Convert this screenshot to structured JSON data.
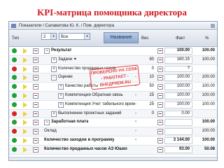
{
  "slide": {
    "title": "KPI-матрица помощника директора"
  },
  "app": {
    "breadcrumb": "Показатели / Салаватова Ю. К. / Пом. директора",
    "filters": {
      "type_label": "Тип",
      "level_value": "2",
      "scope_value": "Все",
      "name_header": "Название",
      "col_weight": "Вес",
      "col_fact": "Факт",
      "col_pct": "%"
    },
    "rows": [
      {
        "status": "green",
        "flag": true,
        "expander": "⊟",
        "name": "Результат",
        "ind": 0,
        "bold": true,
        "w": "",
        "mark": "",
        "v": "100.00",
        "pct": "100.00"
      },
      {
        "status": "green",
        "flag": true,
        "expander": "⊞",
        "name": "Задачи  ✦",
        "ind": 1,
        "bold": false,
        "w": "90",
        "mark": "",
        "v": "160.15",
        "pct": "100.00"
      },
      {
        "status": "red",
        "flag": true,
        "expander": "⊞",
        "name": "Количество проданных часов",
        "ind": 1,
        "bold": false,
        "w": "0",
        "mark": "-",
        "v": "?",
        "pct": ""
      },
      {
        "status": "green",
        "flag": true,
        "expander": "⊟",
        "name": "Оценки",
        "ind": 1,
        "bold": false,
        "w": "10",
        "mark": "-",
        "v": "100.00",
        "pct": "100.00"
      },
      {
        "status": "green",
        "flag": true,
        "expander": "⊞",
        "name": "Качество работы",
        "ind": 2,
        "bold": false,
        "w": "50",
        "mark": "-",
        "v": "100.00",
        "pct": "100.00"
      },
      {
        "status": "green",
        "flag": true,
        "expander": "⊞",
        "name": "Компетенция Обратная связь",
        "ind": 2,
        "bold": false,
        "w": "25",
        "mark": "-",
        "v": "100.00",
        "pct": "100.00"
      },
      {
        "status": "green",
        "flag": true,
        "expander": "⊞",
        "name": "Компетенция Учет табельного времени",
        "ind": 2,
        "bold": false,
        "w": "25",
        "mark": "-",
        "v": "100.00",
        "pct": "100.00"
      },
      {
        "status": "red",
        "flag": true,
        "expander": "⊞",
        "name": "Выполнение проектных заданий",
        "ind": 1,
        "bold": false,
        "w": "0",
        "mark": "-",
        "v": "0.00",
        "pct": ""
      },
      {
        "status": "green",
        "flag": true,
        "expander": "⊟",
        "name": "Заработная плата",
        "ind": 0,
        "bold": true,
        "w": "",
        "mark": "-",
        "v": "",
        "pct": "100.00"
      },
      {
        "status": "red",
        "flag": true,
        "expander": "",
        "name": "Оклад",
        "ind": 0,
        "bold": false,
        "w": "",
        "mark": "-",
        "v": "",
        "pct": "100.00"
      },
      {
        "status": "green",
        "flag": true,
        "expander": "",
        "name": "Количество заходов в программу",
        "ind": 0,
        "bold": true,
        "w": "",
        "mark": "-",
        "v": "3 144.00",
        "pct": "100.00"
      },
      {
        "status": "green",
        "flag": true,
        "expander": "",
        "name": "Количество проданных часов АЗ Юшко",
        "ind": 0,
        "bold": true,
        "w": "",
        "mark": "",
        "v": "93.00",
        "pct": "50.08"
      }
    ],
    "stamp": {
      "line1": "ПРОВЕРЕНО НА СЕБЕ",
      "line2": "- РАБОТАЕТ -",
      "line3": "ВНЕДРЯЕМ.RU"
    },
    "colors": {
      "green": "#1fa038",
      "red": "#d42424",
      "yellow": "#e8d13a",
      "accent": "#d01820"
    }
  }
}
